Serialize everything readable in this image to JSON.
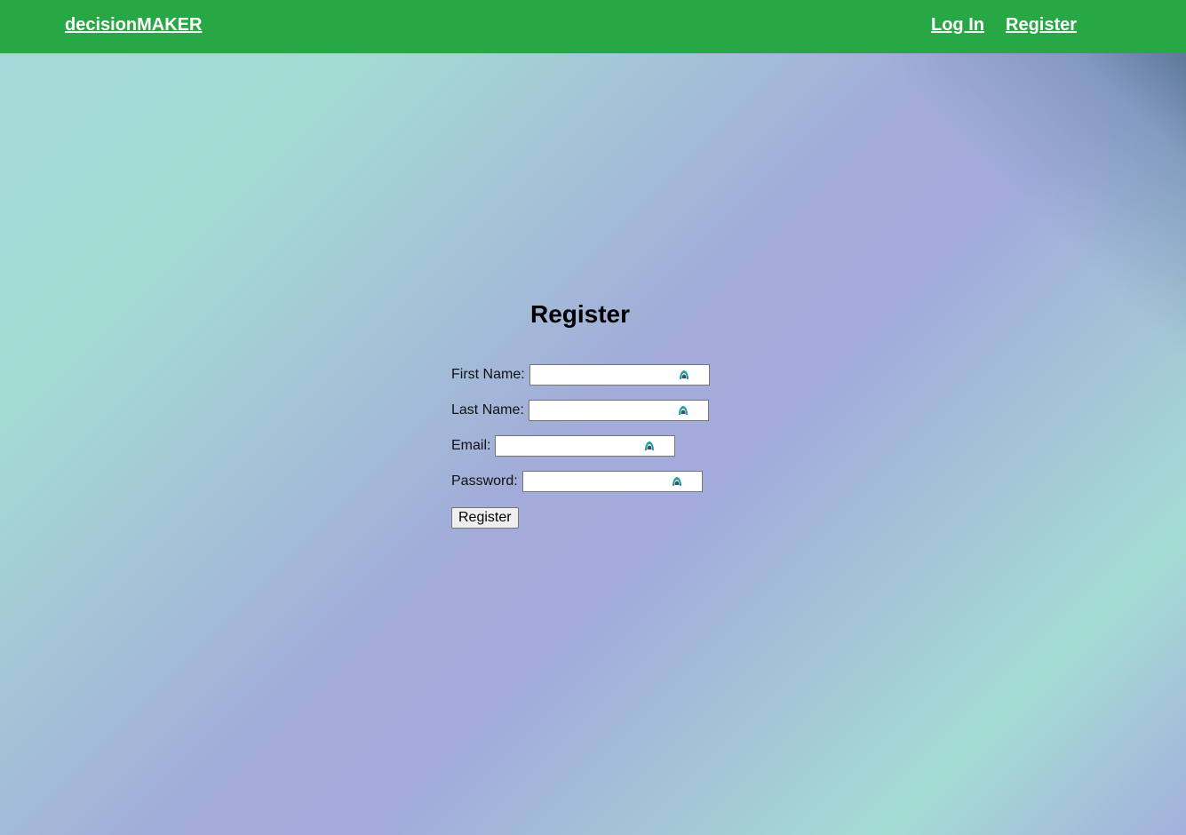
{
  "navbar": {
    "brand": "decisionMAKER",
    "links": [
      {
        "label": "Log In"
      },
      {
        "label": "Register"
      }
    ],
    "background_color": "#28a745"
  },
  "form": {
    "title": "Register",
    "fields": [
      {
        "label": "First Name:",
        "value": ""
      },
      {
        "label": "Last Name:",
        "value": ""
      },
      {
        "label": "Email:",
        "value": ""
      },
      {
        "label": "Password:",
        "value": ""
      }
    ],
    "submit_label": "Register",
    "field_icon": "password-manager-icon",
    "field_icon_color": "#1ea39a"
  }
}
